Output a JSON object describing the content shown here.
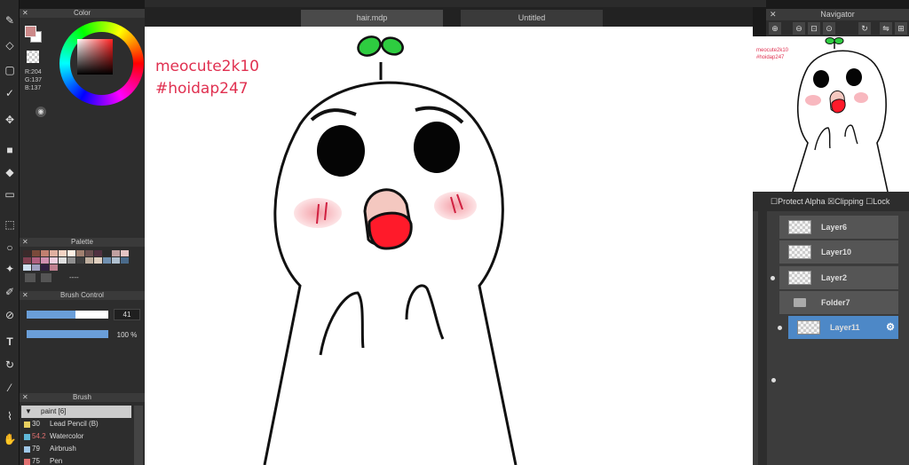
{
  "tabs": [
    "hair.mdp",
    "Untitled"
  ],
  "color": {
    "title": "Color",
    "r": "R:204",
    "g": "G:137",
    "b": "B:137",
    "foreground": "#cc8989",
    "background": "#ffffff"
  },
  "palette": {
    "title": "Palette",
    "colors": [
      "#3a2a2a",
      "#7a4a3a",
      "#c08070",
      "#e0b0a0",
      "#f4d4c4",
      "#fff0e4",
      "#a08070",
      "#6a5050",
      "#503040",
      "#2a2a2a",
      "#c0a0a0",
      "#e4c4c4",
      "#804050",
      "#b06080",
      "#d090b0",
      "#f0d0e0",
      "#e0e0e0",
      "#909090",
      "#404040",
      "#c0b0a0",
      "#e0d0c0",
      "#7090b0",
      "#b0c0d0",
      "#4a6a8a",
      "#d0e0f0",
      "#a0a0c0",
      "#302040",
      "#c08090"
    ],
    "more": "----"
  },
  "brush_control": {
    "title": "Brush Control",
    "size": "41",
    "opacity": "100 %",
    "size_fraction": 0.6,
    "opacity_fraction": 1.0
  },
  "brush": {
    "title": "Brush",
    "group": "paint [6]",
    "items": [
      {
        "num": "30",
        "name": "Lead Pencil (B)",
        "color": "#e8d060"
      },
      {
        "num": "54.2",
        "name": "Watercolor",
        "color": "#60b8d8"
      },
      {
        "num": "79",
        "name": "Airbrush",
        "color": "#a0c8e8"
      },
      {
        "num": "75",
        "name": "Pen",
        "color": "#e07070"
      }
    ]
  },
  "canvas": {
    "credit_line1": "meocute2k10",
    "credit_line2": "#hoidap247"
  },
  "navigator": {
    "title": "Navigator",
    "credit_small": "meocute2k10 #hoidap247"
  },
  "layers": {
    "protect_alpha": "Protect Alpha",
    "clipping": "Clipping",
    "lock": "Lock",
    "rows": [
      {
        "name": "Layer6",
        "type": "layer",
        "visible": false,
        "selected": false
      },
      {
        "name": "Layer10",
        "type": "layer",
        "visible": false,
        "selected": false
      },
      {
        "name": "Layer2",
        "type": "layer",
        "visible": true,
        "selected": false
      },
      {
        "name": "Folder7",
        "type": "folder",
        "visible": false,
        "selected": false
      },
      {
        "name": "Layer11",
        "type": "layer",
        "visible": true,
        "selected": true
      }
    ]
  }
}
